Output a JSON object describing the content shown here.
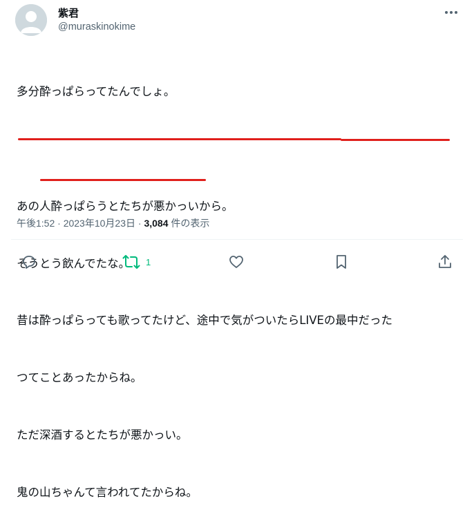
{
  "user": {
    "display_name": "紫君",
    "handle": "@muraskinokime"
  },
  "tweet": {
    "lines": [
      "多分酔っぱらってたんでしょ。",
      "",
      "あの人酔っぱらうとたちが悪かっいから。",
      "そうとう飲んでたな。",
      "昔は酔っぱらっても歌ってたけど、途中で気がついたらLIVEの最中だった",
      "つてことあったからね。",
      "ただ深酒するとたちが悪かっい。",
      "鬼の山ちゃんて言われてたからね。"
    ]
  },
  "meta": {
    "time": "午後1:52",
    "separator1": "·",
    "date": "2023年10月23日",
    "separator2": "·",
    "views_count": "3,084",
    "views_label": "件の表示"
  },
  "actions": {
    "reply_icon": "reply-icon",
    "repost_icon": "repost-icon",
    "repost_count": "1",
    "like_icon": "heart-icon",
    "bookmark_icon": "bookmark-icon",
    "share_icon": "share-icon"
  },
  "colors": {
    "underline": "#e0201c",
    "repost": "#00ba7c",
    "secondary_text": "#536471"
  }
}
